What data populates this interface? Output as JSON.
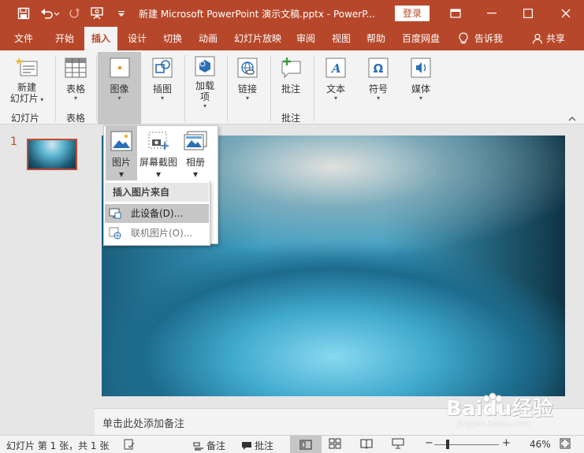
{
  "titlebar": {
    "title": "新建 Microsoft PowerPoint 演示文稿.pptx  -  PowerP...",
    "login": "登录"
  },
  "tabs": [
    "文件",
    "开始",
    "插入",
    "设计",
    "切换",
    "动画",
    "幻灯片放映",
    "审阅",
    "视图",
    "帮助",
    "百度网盘",
    "告诉我",
    "共享"
  ],
  "ribbon": {
    "new_slide": "新建\n幻灯片",
    "slides_group": "幻灯片",
    "table": "表格",
    "tables_group": "表格",
    "images": "图像",
    "illustrations": "插图",
    "addins": "加载\n项",
    "links": "链接",
    "comment": "批注",
    "comments_group": "批注",
    "text": "文本",
    "symbols": "符号",
    "media": "媒体"
  },
  "dropdown": {
    "pictures": "图片",
    "screenshot": "屏幕截图",
    "album": "相册",
    "insert_from": "插入图片来自",
    "this_device": "此设备(D)...",
    "online": "联机图片(O)..."
  },
  "thumbnail": {
    "number": "1"
  },
  "notes": {
    "placeholder": "单击此处添加备注"
  },
  "status": {
    "slide_info": "幻灯片 第 1 张，共 1 张",
    "notes": "备注",
    "comments": "批注",
    "zoom_minus": "−",
    "zoom_plus": "+",
    "zoom": "46%",
    "zoom_fraction": 0.46
  },
  "watermark": {
    "brand": "Baidu经验",
    "url": "jingyan.baidu.com"
  },
  "colors": {
    "accent": "#b7472a",
    "ribbon": "#f3f3f3",
    "pressed": "#c6c6c6"
  }
}
